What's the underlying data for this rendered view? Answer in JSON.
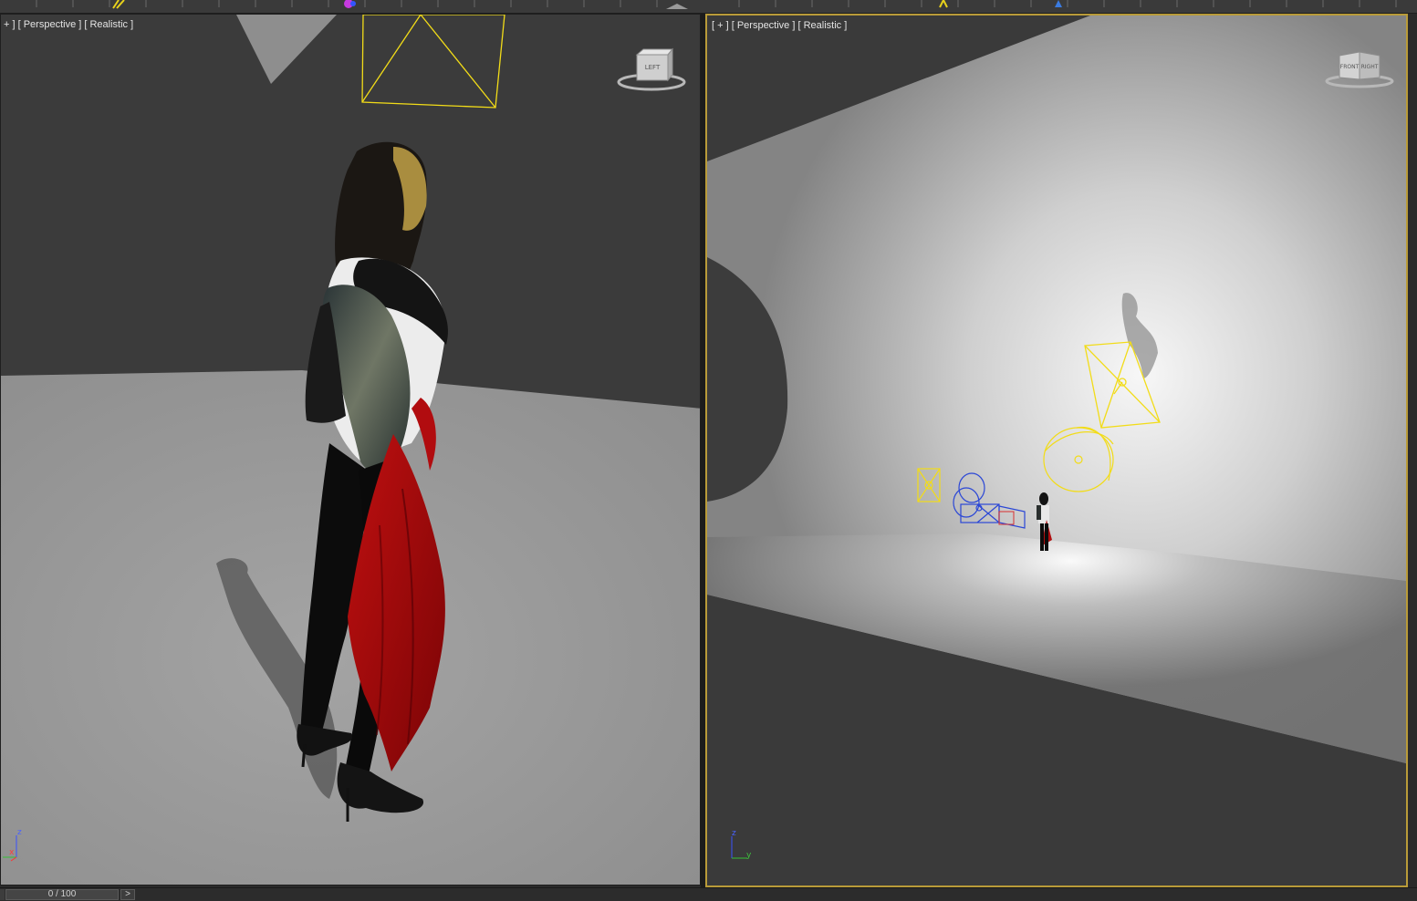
{
  "viewports": {
    "left": {
      "label_menu": "+ ]",
      "label_view": "[ Perspective ]",
      "label_shading": "[ Realistic ]",
      "viewcube_face": "LEFT",
      "axis_z": "z",
      "axis_x": "x"
    },
    "right": {
      "label_menu": "[ + ]",
      "label_view": "[ Perspective ]",
      "label_shading": "[ Realistic ]",
      "viewcube_face_1": "FRONT",
      "viewcube_face_2": "RIGHT",
      "axis_z": "z",
      "axis_y": "y"
    }
  },
  "timeline": {
    "slider_text": "0 / 100",
    "next_label": ">",
    "current_frame": 0,
    "total_frames": 100
  },
  "colors": {
    "active_viewport_border": "#b99b39",
    "light_gizmo": "#f2dc18",
    "camera_gizmo": "#2b47d6",
    "cloth_red": "#a4090b"
  },
  "icons": {
    "viewcube": "viewcube-icon",
    "axis_tripod": "axis-tripod-icon"
  }
}
